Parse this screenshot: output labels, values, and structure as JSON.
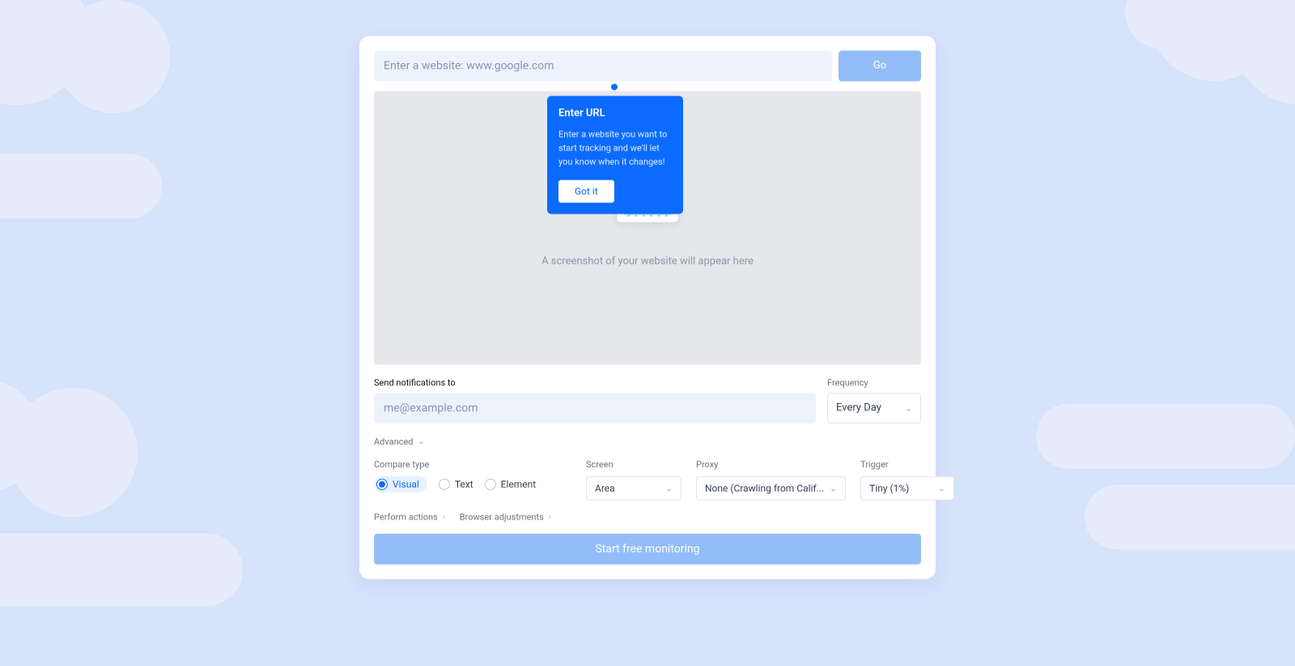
{
  "url_input": {
    "placeholder": "Enter a website: www.google.com",
    "value": ""
  },
  "go_label": "Go",
  "tooltip": {
    "title": "Enter URL",
    "body": "Enter a website you want to start tracking and we'll let you know when it changes!",
    "button": "Got it"
  },
  "preview_text": "A screenshot of your website will appear here",
  "notifications": {
    "label": "Send notifications to",
    "placeholder": "me@example.com",
    "value": ""
  },
  "frequency": {
    "label": "Frequency",
    "value": "Every Day"
  },
  "advanced_label": "Advanced",
  "compare": {
    "label": "Compare type",
    "options": [
      "Visual",
      "Text",
      "Element"
    ],
    "selected": "Visual"
  },
  "screen": {
    "label": "Screen",
    "value": "Area"
  },
  "proxy": {
    "label": "Proxy",
    "value": "None (Crawling from Calif..."
  },
  "trigger": {
    "label": "Trigger",
    "value": "Tiny (1%)"
  },
  "links": {
    "perform": "Perform actions",
    "browser": "Browser adjustments"
  },
  "submit_label": "Start free monitoring",
  "colors": {
    "accent": "#0b6bff",
    "accent_light": "#93bdf8",
    "bg": "#d7e2fb"
  }
}
